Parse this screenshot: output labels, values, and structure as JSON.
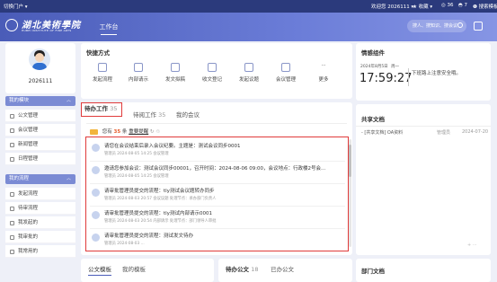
{
  "topbar": {
    "left": "切换门户 ▾",
    "welcome": "欢迎您 2026111 ▾",
    "fav": "★ 收藏 ▾",
    "count36": "◎ 36",
    "count7": "◓ 7",
    "search_help": "❶ 搜索模板"
  },
  "header": {
    "logo_text": "湖北美術學院",
    "logo_sub": "HUBEI INSTITUTE OF FINE ARTS",
    "tab_label": "工作台",
    "search_placeholder": "搜人、搜知识、搜会议"
  },
  "profile": {
    "name": "2026111"
  },
  "sidebar": {
    "module_header": "我的模块",
    "modules": [
      {
        "label": "公文管理"
      },
      {
        "label": "会议管理"
      },
      {
        "label": "新闻管理"
      },
      {
        "label": "日程管理"
      }
    ],
    "process_header": "我的流程",
    "processes": [
      {
        "label": "发起流程"
      },
      {
        "label": "待审流程"
      },
      {
        "label": "我发起的"
      },
      {
        "label": "我审批的"
      },
      {
        "label": "我常用的"
      }
    ]
  },
  "quick": {
    "title": "快捷方式",
    "items": [
      {
        "label": "发起流程"
      },
      {
        "label": "内部请示"
      },
      {
        "label": "发文拟稿"
      },
      {
        "label": "收文登记"
      },
      {
        "label": "发起议题"
      },
      {
        "label": "会议管理"
      },
      {
        "label": "更多"
      }
    ]
  },
  "work": {
    "tab_pending": "待办工作",
    "tab_pending_count": "35",
    "tab_read": "待阅工作",
    "tab_read_count": "35",
    "tab_meeting": "我的会议",
    "notice_prefix": "您有",
    "notice_count": "35",
    "notice_suffix": "条",
    "notice_link": "重要提醒",
    "rows": [
      {
        "title": "请您在会议结束后录入会议纪要。主题是：测试会议同步0001",
        "meta": "管理员    2024-08-05 14:25    会议管理"
      },
      {
        "title": "邀请您参加会议：测试会议同步00001，召开时间：2024-08-06 09:00，会议地点：行政楼2号会...",
        "meta": "管理员    2024-08-05 14:25    会议管理"
      },
      {
        "title": "请审批管理员提交的流程：tly测试会议题转办同步",
        "meta": "管理员    2024-08-03 20:57    会议议题    处理节点：承办部门负责人"
      },
      {
        "title": "请审批管理员提交的流程：tly测试内部请示0001",
        "meta": "管理员    2024-08-03 20:54    内部请示    处理节点：部门领导人审批"
      },
      {
        "title": "请审批管理员提交的流程：测试发文待办",
        "meta": "管理员    2024-08-03 ..."
      }
    ]
  },
  "template_card": {
    "tab1": "公文模板",
    "tab2": "我的模板"
  },
  "pub_card": {
    "tab1": "待办公文",
    "tab1_count": "18",
    "tab2": "已办公文"
  },
  "info": {
    "title": "情感组件",
    "date": "2024年8月5日",
    "weekday": "周一",
    "clock": "17:59:27",
    "tip": "下班路上注意安全哦。"
  },
  "share": {
    "title": "共享文档",
    "doc_title": "- [共享文档] OA资料",
    "doc_author": "管理员",
    "doc_date": "2024-07-20",
    "pager": "+ ···"
  },
  "dept": {
    "title": "部门文档"
  }
}
